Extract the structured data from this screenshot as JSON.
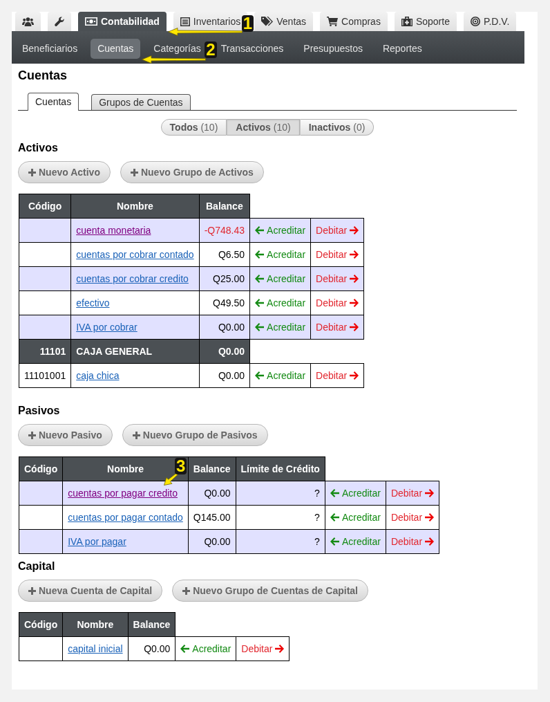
{
  "top_tabs": [
    {
      "selected": false
    },
    {
      "selected": false
    },
    {
      "label": "Contabilidad",
      "selected": true,
      "callout": "1"
    },
    {
      "label": "Inventarios",
      "selected": false
    },
    {
      "label": "Ventas",
      "selected": false
    },
    {
      "label": "Compras",
      "selected": false
    },
    {
      "label": "Soporte",
      "selected": false
    },
    {
      "label": "P.D.V.",
      "selected": false
    }
  ],
  "subnav": [
    {
      "label": "Beneficiarios",
      "selected": false
    },
    {
      "label": "Cuentas",
      "selected": true,
      "callout": "2"
    },
    {
      "label": "Categorías",
      "selected": false
    },
    {
      "label": "Transacciones",
      "selected": false
    },
    {
      "label": "Presupuestos",
      "selected": false
    },
    {
      "label": "Reportes",
      "selected": false
    }
  ],
  "page_title": "Cuentas",
  "view_tabs": [
    {
      "label": "Cuentas",
      "selected": true
    },
    {
      "label": "Grupos de Cuentas",
      "selected": false
    }
  ],
  "filter": [
    {
      "label": "Todos",
      "count": "(10)",
      "selected": false
    },
    {
      "label": "Activos",
      "count": "(10)",
      "selected": true
    },
    {
      "label": "Inactivos",
      "count": "(0)",
      "selected": false
    }
  ],
  "sections": [
    {
      "title": "Activos",
      "buttons": [
        "Nuevo Activo",
        "Nuevo Grupo de Activos"
      ],
      "columns": [
        "Código",
        "Nombre",
        "Balance"
      ],
      "rows": [
        {
          "kind": "account",
          "highlighted": true,
          "name": "cuenta monetaria",
          "visited": true,
          "balance": "-Q748.43",
          "negative": true,
          "credit": "Acreditar",
          "debit": "Debitar"
        },
        {
          "kind": "account",
          "highlighted": false,
          "name": "cuentas por cobrar contado",
          "visited": false,
          "balance": "Q6.50",
          "negative": false,
          "credit": "Acreditar",
          "debit": "Debitar"
        },
        {
          "kind": "account",
          "highlighted": true,
          "name": "cuentas por cobrar credito",
          "visited": false,
          "balance": "Q25.00",
          "negative": false,
          "credit": "Acreditar",
          "debit": "Debitar"
        },
        {
          "kind": "account",
          "highlighted": false,
          "name": "efectivo",
          "visited": false,
          "balance": "Q49.50",
          "negative": false,
          "credit": "Acreditar",
          "debit": "Debitar"
        },
        {
          "kind": "account",
          "highlighted": true,
          "name": "IVA por cobrar",
          "visited": false,
          "balance": "Q0.00",
          "negative": false,
          "credit": "Acreditar",
          "debit": "Debitar"
        },
        {
          "kind": "group",
          "code": "11101",
          "name": "CAJA GENERAL",
          "balance": "Q0.00"
        },
        {
          "kind": "account",
          "highlighted": false,
          "code": "11101001",
          "name": "caja chica",
          "visited": false,
          "balance": "Q0.00",
          "negative": false,
          "credit": "Acreditar",
          "debit": "Debitar"
        }
      ]
    },
    {
      "title": "Pasivos",
      "buttons": [
        "Nuevo Pasivo",
        "Nuevo Grupo de Pasivos"
      ],
      "columns": [
        "Código",
        "Nombre",
        "Balance",
        "Límite de Crédito"
      ],
      "rows": [
        {
          "kind": "account",
          "highlighted": true,
          "name": "cuentas por pagar credito",
          "visited": true,
          "callout": "3",
          "balance": "Q0.00",
          "negative": false,
          "credit_limit": "?",
          "credit": "Acreditar",
          "debit": "Debitar"
        },
        {
          "kind": "account",
          "highlighted": false,
          "name": "cuentas por pagar contado",
          "visited": false,
          "balance": "Q145.00",
          "negative": false,
          "credit_limit": "?",
          "credit": "Acreditar",
          "debit": "Debitar"
        },
        {
          "kind": "account",
          "highlighted": true,
          "name": "IVA por pagar",
          "visited": false,
          "balance": "Q0.00",
          "negative": false,
          "credit_limit": "?",
          "credit": "Acreditar",
          "debit": "Debitar"
        }
      ]
    },
    {
      "title": "Capital",
      "buttons": [
        "Nueva Cuenta de Capital",
        "Nuevo Grupo de Cuentas de Capital"
      ],
      "columns": [
        "Código",
        "Nombre",
        "Balance"
      ],
      "rows": [
        {
          "kind": "account",
          "highlighted": false,
          "name": "capital inicial",
          "visited": false,
          "balance": "Q0.00",
          "negative": false,
          "credit": "Acreditar",
          "debit": "Debitar"
        }
      ]
    }
  ]
}
